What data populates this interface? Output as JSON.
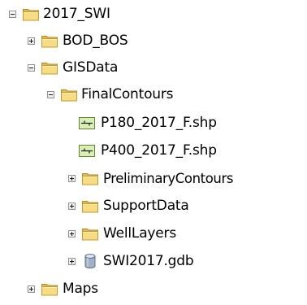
{
  "tree": {
    "root": {
      "label": "2017_SWI",
      "expanded": true,
      "icon": "folder-icon",
      "children": [
        {
          "label": "BOD_BOS",
          "expanded": false,
          "icon": "folder-icon"
        },
        {
          "label": "GISData",
          "expanded": true,
          "icon": "folder-icon",
          "children": [
            {
              "label": "FinalContours",
              "expanded": true,
              "icon": "folder-icon",
              "children": [
                {
                  "label": "P180_2017_F.shp",
                  "icon": "line-shapefile-icon"
                },
                {
                  "label": "P400_2017_F.shp",
                  "icon": "line-shapefile-icon"
                }
              ]
            },
            {
              "label": "PreliminaryContours",
              "expanded": false,
              "icon": "folder-icon"
            },
            {
              "label": "SupportData",
              "expanded": false,
              "icon": "folder-icon"
            },
            {
              "label": "WellLayers",
              "expanded": false,
              "icon": "folder-icon"
            },
            {
              "label": "SWI2017.gdb",
              "expanded": false,
              "icon": "geodatabase-icon"
            }
          ]
        },
        {
          "label": "Maps",
          "expanded": false,
          "icon": "folder-icon"
        }
      ]
    }
  },
  "colors": {
    "folder_fill": "#f4d57a",
    "folder_edge": "#c79a2b",
    "shapefile_fill": "#d9efb3",
    "shapefile_edge": "#5e8a2e",
    "geodatabase_fill": "#9fb1c6",
    "toggle_border": "#919191"
  }
}
